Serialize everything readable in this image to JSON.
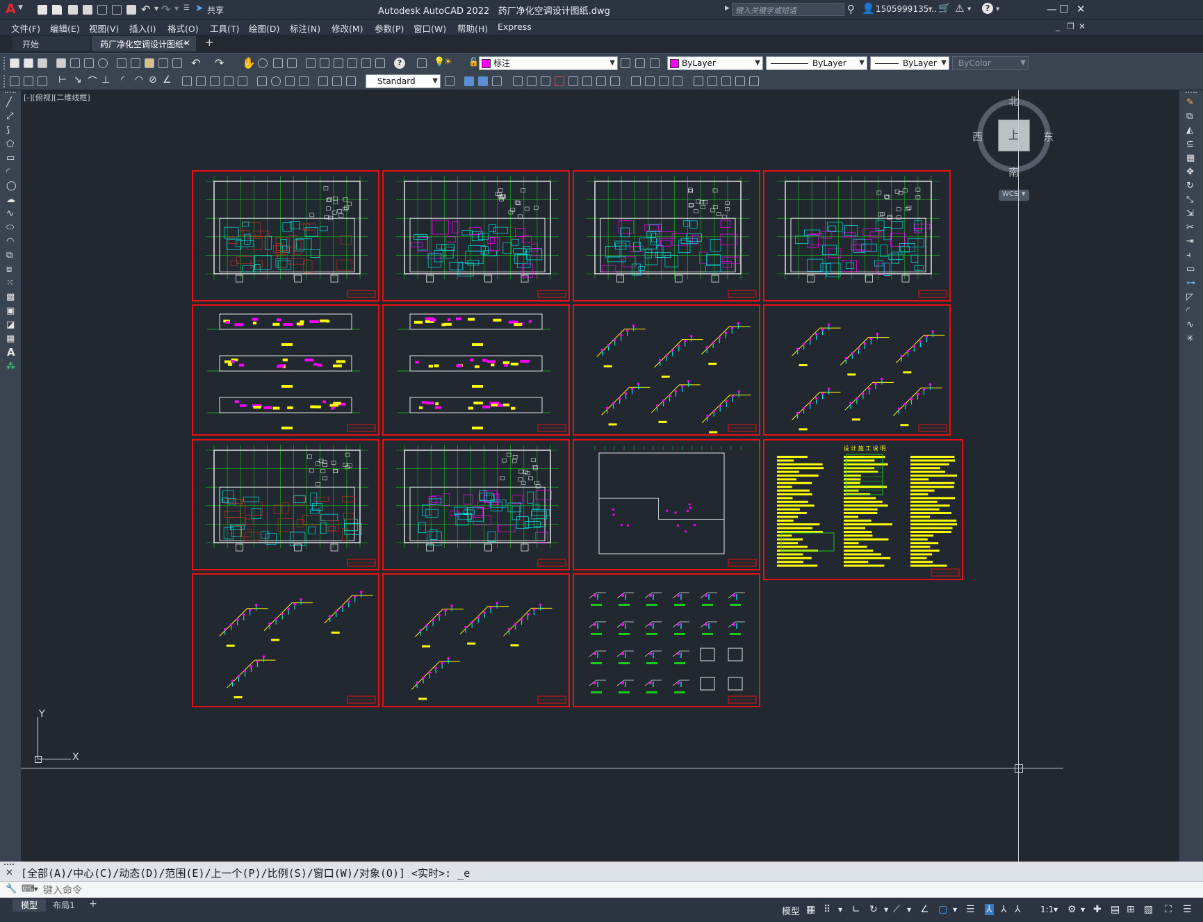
{
  "app": {
    "product": "Autodesk AutoCAD 2022",
    "filename": "药厂净化空调设计图纸.dwg",
    "share_label": "共享",
    "search_placeholder": "键入关键字或短语",
    "user": "1505999135...",
    "logo_letter": "A"
  },
  "menu": [
    "文件(F)",
    "编辑(E)",
    "视图(V)",
    "插入(I)",
    "格式(O)",
    "工具(T)",
    "绘图(D)",
    "标注(N)",
    "修改(M)",
    "参数(P)",
    "窗口(W)",
    "帮助(H)",
    "Express"
  ],
  "tabs": {
    "start": "开始",
    "active": "药厂净化空调设计图纸*",
    "add": "+"
  },
  "toolbar": {
    "layer_value": "标注",
    "color_value": "ByLayer",
    "linetype_value": "ByLayer",
    "lineweight_value": "ByLayer",
    "plotstyle_value": "ByColor",
    "textstyle_value": "Standard"
  },
  "viewport": {
    "label": "[-][俯视][二维线框]",
    "compass": {
      "north": "北",
      "south": "南",
      "east": "东",
      "west": "西",
      "top": "上"
    },
    "wcs": "WCS",
    "ucs_x": "X",
    "ucs_y": "Y"
  },
  "sheets": {
    "notes_title": "设 计 施 工 说 明"
  },
  "command": {
    "history": "[全部(A)/中心(C)/动态(D)/范围(E)/上一个(P)/比例(S)/窗口(W)/对象(O)] <实时>: _e",
    "placeholder": "键入命令"
  },
  "status": {
    "layout_tabs": [
      "模型",
      "布局1"
    ],
    "add_tab": "+",
    "model_label": "模型",
    "scale": "1:1"
  },
  "colors": {
    "sheet_border": "#e81010",
    "canvas": "#212830",
    "accent_magenta": "#ff00ff",
    "wall_white": "#e6e6e6",
    "grid_green": "#19c819",
    "cyan": "#00e5e5",
    "yellow": "#ffff00"
  }
}
